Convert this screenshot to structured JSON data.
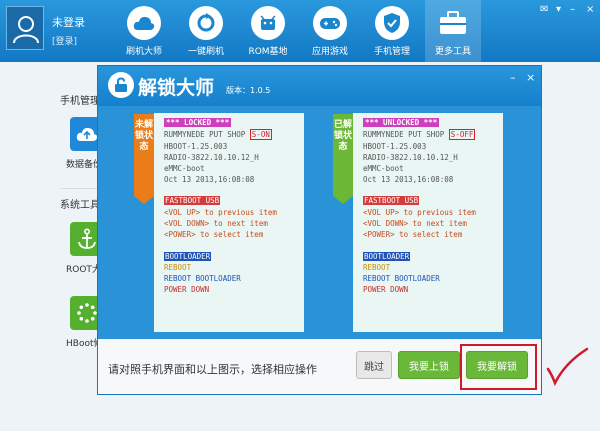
{
  "user": {
    "name": "未登录",
    "sub": "[登录]"
  },
  "nav": [
    {
      "label": "刷机大师",
      "icon": "cloud-icon"
    },
    {
      "label": "一键刷机",
      "icon": "refresh-icon"
    },
    {
      "label": "ROM基地",
      "icon": "android-icon"
    },
    {
      "label": "应用游戏",
      "icon": "gamepad-icon"
    },
    {
      "label": "手机管理",
      "icon": "shield-icon"
    },
    {
      "label": "更多工具",
      "icon": "toolbox-icon"
    }
  ],
  "sidebar": {
    "section1": "手机管理",
    "item1": "数据备份",
    "section2": "系统工具",
    "item2": "ROOT大",
    "item3": "HBoot修"
  },
  "dialog": {
    "title": "解锁大师",
    "version": "版本：1.0.5",
    "locked_ribbon": "未解锁状态",
    "unlocked_ribbon": "已解锁状态",
    "locked_screen": {
      "status": "*** LOCKED ***",
      "line1": "RUMMYNEDE PUT SHOP",
      "soff": "S-ON",
      "line2": "HBOOT-1.25.003",
      "line3": "RADIO-3822.10.10.12_H",
      "line4": "eMMC-boot",
      "line5": "Oct 13 2013,16:08:08",
      "fastboot": "FASTBOOT USB",
      "vol_up": "<VOL UP> to previous item",
      "vol_down": "<VOL DOWN> to next item",
      "power": "<POWER> to select item",
      "bootloader": "BOOTLOADER",
      "reboot": "REBOOT",
      "reboot_bl": "REBOOT BOOTLOADER",
      "power_down": "POWER DOWN"
    },
    "unlocked_screen": {
      "status": "*** UNLOCKED ***",
      "line1": "RUMMYNEDE PUT SHOP",
      "soff": "S-OFF",
      "line2": "HBOOT-1.25.003",
      "line3": "RADIO-3822.10.10.12_H",
      "line4": "eMMC-boot",
      "line5": "Oct 13 2013,16:08:08",
      "fastboot": "FASTBOOT USB",
      "vol_up": "<VOL UP> to previous item",
      "vol_down": "<VOL DOWN> to next item",
      "power": "<POWER> to select item",
      "bootloader": "BOOTLOADER",
      "reboot": "REBOOT",
      "reboot_bl": "REBOOT BOOTLOADER",
      "power_down": "POWER DOWN"
    },
    "instruction": "请对照手机界面和以上图示，选择相应操作",
    "skip": "跳过",
    "lock": "我要上锁",
    "unlock": "我要解锁"
  },
  "colors": {
    "accent": "#1a86d0",
    "green": "#6ab83a",
    "orange": "#ea7d1a",
    "highlight": "#d0192b"
  }
}
